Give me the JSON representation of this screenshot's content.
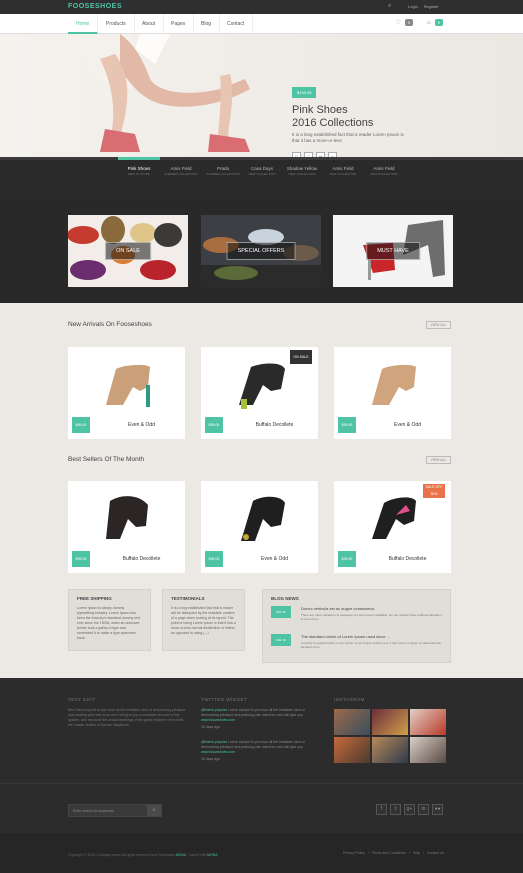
{
  "topbar": {
    "logo": "FOOSESHOES",
    "search_icon": "⌕",
    "links": [
      "Login",
      "Register"
    ]
  },
  "nav": {
    "items": [
      "Home",
      "Products",
      "About",
      "Pages",
      "Blog",
      "Contact"
    ],
    "wishlist_count": "0",
    "cart_count": "0"
  },
  "hero": {
    "tag": "$149.99",
    "title_line1": "Pink Shoes",
    "title_line2": "2016 Collections",
    "subtitle": "It is a long established fact that a reader Lorem Ipsum is that it has a more-or-less"
  },
  "tabs": [
    {
      "name": "Pink Shoes",
      "sub": "NEW IN STORE"
    },
    {
      "name": "Amis Field",
      "sub": "SUMMER COLLECTION"
    },
    {
      "name": "Prada",
      "sub": "SUMMER COLLECTION"
    },
    {
      "name": "Casa Days",
      "sub": "NEW COLLECTION"
    },
    {
      "name": "Shadow Yellow",
      "sub": "NEW COLLECTION"
    },
    {
      "name": "Amis Field",
      "sub": "2016 COLLECTION"
    },
    {
      "name": "Amis Field",
      "sub": "2016 COLLECTION"
    }
  ],
  "promos": [
    "ON SALE",
    "SPECIAL OFFERS",
    "MUST HAVE"
  ],
  "new_arrivals": {
    "title": "New Arrivals On Fooseshoes",
    "button": "VIEW ALL",
    "items": [
      {
        "name": "Even & Odd",
        "price": "$99.00"
      },
      {
        "name": "Buffalo Decollete",
        "price": "$99.00",
        "ribbon": "ON SALE"
      },
      {
        "name": "Even & Odd",
        "price": "$99.00"
      }
    ]
  },
  "best_sellers": {
    "title": "Best Sellers Of The Month",
    "button": "VIEW ALL",
    "items": [
      {
        "name": "Buffalo Decollete",
        "price": "$99.00"
      },
      {
        "name": "Even & Odd",
        "price": "$99.00"
      },
      {
        "name": "Buffalo Decollete",
        "price": "$99.00",
        "ribbon": "SALE OFF 30%"
      }
    ]
  },
  "free_shipping": {
    "title": "FREE SHIPPING",
    "text": "Lorem Ipsum is simply dummy typesetting industry. Lorem Ipsum has been the industry's standard dummy text ever since the 1500s, when an unknown printer took a galley of type and scrambled it to make a type specimen book."
  },
  "testimonials": {
    "title": "TESTIMONIALS",
    "text": "It is a long established fact that a reader will be distracted by the readable content of a page when looking at its layout. The point of using Lorem Ipsum is that it has a more-or-less normal distribution of letters, as opposed to using (...)"
  },
  "blog": {
    "title": "BLOG NEWS",
    "items": [
      {
        "date": "Mar 16",
        "heading": "Donec vehicula est ac augue consectetur,",
        "text": "There are many variations of passages of Lorem Ipsum available, but the majority have suffered alteration in some form"
      },
      {
        "date": "Mar 16",
        "heading": "The standard chunk of Lorem Ipsum used since ...",
        "text": "Contrary to popular belief, Lorem Ipsum is not simply random text. It has roots in a piece of classical Latin literature from"
      }
    ]
  },
  "footer": {
    "text_title": "TEXT EDIT",
    "text_body": "Ben Hand expedit so you hear all the mistaken idea of denouncing pleasure and praising pain was born and I will give you a complete account of the system, and expound the actual teachings of the great explorer of the truth, the master-builder of human happiness.",
    "twitter_title": "TWITTER WIDGET",
    "tweets": [
      {
        "handle": "@theme popular",
        "text": "Lorem explain to you how all the mistaken idea of denouncing pleasure and praising pain was born and will give you",
        "link": "www.fooseshoes.com",
        "time": "15 days ago"
      },
      {
        "handle": "@theme popular",
        "text": "Lorem explain to you how all the mistaken idea of denouncing pleasure and praising pain was born and will give you",
        "link": "www.fooseshoes.com",
        "time": "15 days ago"
      }
    ],
    "instagram_title": "INSTAGRAM",
    "search_placeholder": "Enter search for keywords",
    "search_icon": "⌕",
    "social": [
      "f",
      "t",
      "g+",
      "in",
      "●●"
    ],
    "copyright_pre": "Copyright © 2016 Company name All rights reserved from Templates",
    "copyright_brand": "MONA",
    "copyright_mid": "· Latest Visit",
    "copyright_brand2": "MONA",
    "links": [
      "Privacy Policy",
      "/",
      "Terms And Conditions",
      "/",
      "Help",
      "/",
      "Contact Us"
    ]
  },
  "colors": {
    "accent": "#4fc4a5",
    "dark": "#2b2b2b",
    "light_bg": "#ece9e4",
    "sale": "#e8724a"
  }
}
